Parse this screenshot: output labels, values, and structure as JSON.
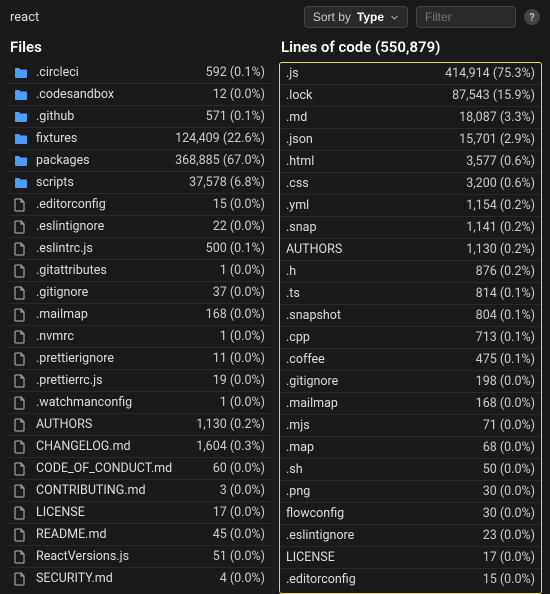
{
  "repo": "react",
  "sort": {
    "prefix": "Sort by",
    "value": "Type"
  },
  "filter_placeholder": "Filter",
  "files_header": "Files",
  "loc_header": "Lines of code (550,879)",
  "files": [
    {
      "name": ".circleci",
      "type": "folder",
      "count": "592",
      "pct": "(0.1%)"
    },
    {
      "name": ".codesandbox",
      "type": "folder",
      "count": "12",
      "pct": "(0.0%)"
    },
    {
      "name": ".github",
      "type": "folder",
      "count": "571",
      "pct": "(0.1%)"
    },
    {
      "name": "fixtures",
      "type": "folder",
      "count": "124,409",
      "pct": "(22.6%)"
    },
    {
      "name": "packages",
      "type": "folder",
      "count": "368,885",
      "pct": "(67.0%)"
    },
    {
      "name": "scripts",
      "type": "folder",
      "count": "37,578",
      "pct": "(6.8%)"
    },
    {
      "name": ".editorconfig",
      "type": "file",
      "count": "15",
      "pct": "(0.0%)"
    },
    {
      "name": ".eslintignore",
      "type": "file",
      "count": "22",
      "pct": "(0.0%)"
    },
    {
      "name": ".eslintrc.js",
      "type": "file",
      "count": "500",
      "pct": "(0.1%)"
    },
    {
      "name": ".gitattributes",
      "type": "file",
      "count": "1",
      "pct": "(0.0%)"
    },
    {
      "name": ".gitignore",
      "type": "file",
      "count": "37",
      "pct": "(0.0%)"
    },
    {
      "name": ".mailmap",
      "type": "file",
      "count": "168",
      "pct": "(0.0%)"
    },
    {
      "name": ".nvmrc",
      "type": "file",
      "count": "1",
      "pct": "(0.0%)"
    },
    {
      "name": ".prettierignore",
      "type": "file",
      "count": "11",
      "pct": "(0.0%)"
    },
    {
      "name": ".prettierrc.js",
      "type": "file",
      "count": "19",
      "pct": "(0.0%)"
    },
    {
      "name": ".watchmanconfig",
      "type": "file",
      "count": "1",
      "pct": "(0.0%)"
    },
    {
      "name": "AUTHORS",
      "type": "file",
      "count": "1,130",
      "pct": "(0.2%)"
    },
    {
      "name": "CHANGELOG.md",
      "type": "file",
      "count": "1,604",
      "pct": "(0.3%)"
    },
    {
      "name": "CODE_OF_CONDUCT.md",
      "type": "file",
      "count": "60",
      "pct": "(0.0%)"
    },
    {
      "name": "CONTRIBUTING.md",
      "type": "file",
      "count": "3",
      "pct": "(0.0%)"
    },
    {
      "name": "LICENSE",
      "type": "file",
      "count": "17",
      "pct": "(0.0%)"
    },
    {
      "name": "README.md",
      "type": "file",
      "count": "45",
      "pct": "(0.0%)"
    },
    {
      "name": "ReactVersions.js",
      "type": "file",
      "count": "51",
      "pct": "(0.0%)"
    },
    {
      "name": "SECURITY.md",
      "type": "file",
      "count": "4",
      "pct": "(0.0%)"
    }
  ],
  "loc": [
    {
      "ext": ".js",
      "count": "414,914",
      "pct": "(75.3%)"
    },
    {
      "ext": ".lock",
      "count": "87,543",
      "pct": "(15.9%)"
    },
    {
      "ext": ".md",
      "count": "18,087",
      "pct": "(3.3%)"
    },
    {
      "ext": ".json",
      "count": "15,701",
      "pct": "(2.9%)"
    },
    {
      "ext": ".html",
      "count": "3,577",
      "pct": "(0.6%)"
    },
    {
      "ext": ".css",
      "count": "3,200",
      "pct": "(0.6%)"
    },
    {
      "ext": ".yml",
      "count": "1,154",
      "pct": "(0.2%)"
    },
    {
      "ext": ".snap",
      "count": "1,141",
      "pct": "(0.2%)"
    },
    {
      "ext": "AUTHORS",
      "count": "1,130",
      "pct": "(0.2%)"
    },
    {
      "ext": ".h",
      "count": "876",
      "pct": "(0.2%)"
    },
    {
      "ext": ".ts",
      "count": "814",
      "pct": "(0.1%)"
    },
    {
      "ext": ".snapshot",
      "count": "804",
      "pct": "(0.1%)"
    },
    {
      "ext": ".cpp",
      "count": "713",
      "pct": "(0.1%)"
    },
    {
      "ext": ".coffee",
      "count": "475",
      "pct": "(0.1%)"
    },
    {
      "ext": ".gitignore",
      "count": "198",
      "pct": "(0.0%)"
    },
    {
      "ext": ".mailmap",
      "count": "168",
      "pct": "(0.0%)"
    },
    {
      "ext": ".mjs",
      "count": "71",
      "pct": "(0.0%)"
    },
    {
      "ext": ".map",
      "count": "68",
      "pct": "(0.0%)"
    },
    {
      "ext": ".sh",
      "count": "50",
      "pct": "(0.0%)"
    },
    {
      "ext": ".png",
      "count": "30",
      "pct": "(0.0%)"
    },
    {
      "ext": "flowconfig",
      "count": "30",
      "pct": "(0.0%)"
    },
    {
      "ext": ".eslintignore",
      "count": "23",
      "pct": "(0.0%)"
    },
    {
      "ext": "LICENSE",
      "count": "17",
      "pct": "(0.0%)"
    },
    {
      "ext": ".editorconfig",
      "count": "15",
      "pct": "(0.0%)"
    }
  ]
}
